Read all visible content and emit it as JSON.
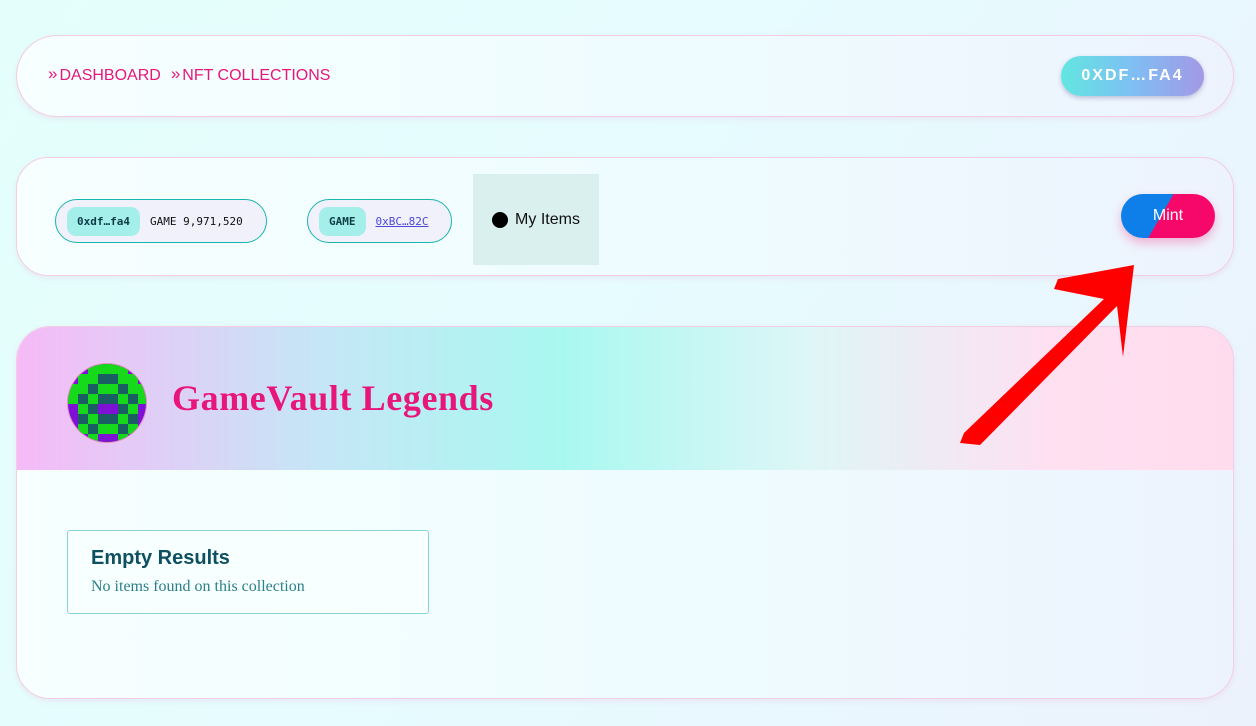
{
  "nav": {
    "crumbs": [
      {
        "icon": "double-chevron-right-icon",
        "label": "DASHBOARD"
      },
      {
        "icon": "double-chevron-right-icon",
        "label": "NFT COLLECTIONS"
      }
    ],
    "wallet_label": "0XDF…FA4"
  },
  "toolbar": {
    "owner_chip": {
      "tag": "0xdf…fa4",
      "value": "GAME 9,971,520"
    },
    "token_chip": {
      "tag": "GAME",
      "link": "0xBC…82C"
    },
    "my_items_label": "My Items",
    "mint_label": "Mint"
  },
  "collection": {
    "title": "GameVault Legends",
    "empty": {
      "heading": "Empty Results",
      "message": "No items found on this collection"
    }
  },
  "colors": {
    "accent": "#e8157a",
    "mint_blue": "#0e7fe8",
    "mint_pink": "#f5086a",
    "annotation_arrow": "#ff0000"
  }
}
